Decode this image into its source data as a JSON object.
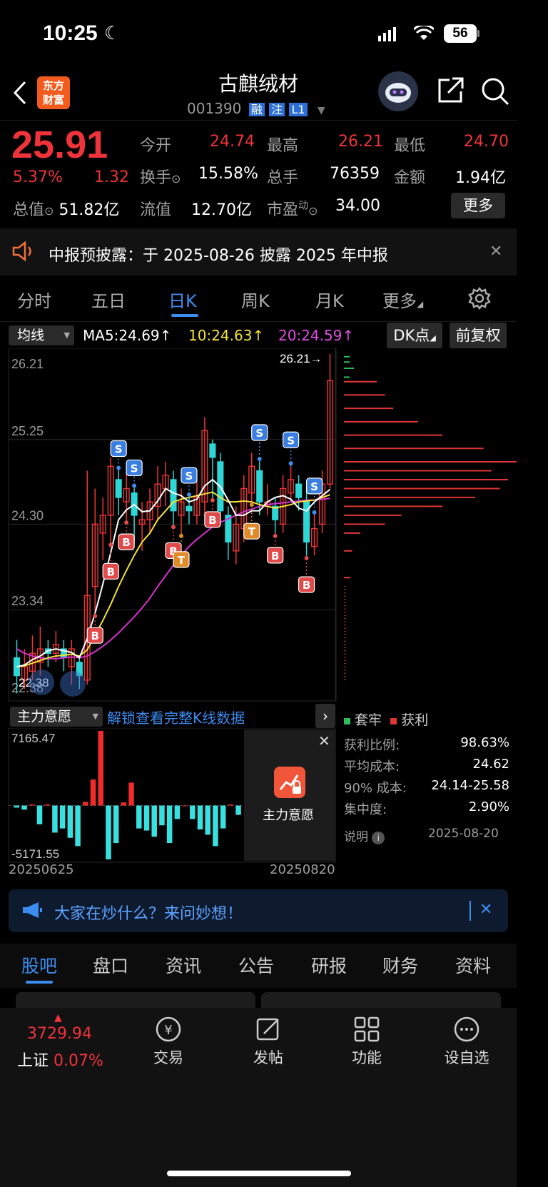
{
  "status_bar": {
    "time": "10:25",
    "battery": "56"
  },
  "header": {
    "logo_line1": "东方",
    "logo_line2": "财富",
    "stock_name": "古麒绒材",
    "stock_code": "001390",
    "tags": [
      "融",
      "注",
      "L1"
    ]
  },
  "quote": {
    "price": "25.91",
    "change_pct": "5.37%",
    "change": "1.32",
    "total_value_label": "总值",
    "total_value": "51.82亿",
    "open_label": "今开",
    "open": "24.74",
    "high_label": "最高",
    "high": "26.21",
    "low_label": "最低",
    "low": "24.70",
    "turnover_label": "换手",
    "turnover": "15.58%",
    "volume_label": "总手",
    "volume": "76359",
    "amount_label": "金额",
    "amount": "1.94亿",
    "float_label": "流值",
    "float_value": "12.70亿",
    "pe_label": "市盈",
    "pe_sup": "动",
    "pe": "34.00",
    "more_button": "更多"
  },
  "notice": {
    "text": "中报预披露：于 2025-08-26 披露 2025 年中报"
  },
  "tabs": {
    "items": [
      "分时",
      "五日",
      "日K",
      "周K",
      "月K",
      "更多"
    ],
    "active": "日K"
  },
  "ma_bar": {
    "dropdown": "均线",
    "ma5": "MA5:24.69↑",
    "ma10": "10:24.63↑",
    "ma20": "20:24.59↑",
    "dk_button": "DK点",
    "adjust_button": "前复权",
    "ma5_color": "#ffffff",
    "ma10_color": "#f5e236",
    "ma20_color": "#d62fd0"
  },
  "kline": {
    "price_labels": [
      "26.21",
      "25.25",
      "24.30",
      "23.34",
      "22.38"
    ],
    "max_marker": "26.21→",
    "min_marker": "22.38",
    "signal_s": "S",
    "signal_b": "B",
    "signal_t": "T"
  },
  "indicator": {
    "dropdown": "主力意愿",
    "unlock_text": "解锁查看完整K线数据",
    "max": "7165.47",
    "min": "-5171.55",
    "date_start": "20250625",
    "date_end": "20250820",
    "lock_label": "主力意愿"
  },
  "chip": {
    "legend_trapped": "套牢",
    "legend_profit": "获利",
    "rows": [
      {
        "label": "获利比例:",
        "value": "98.63%"
      },
      {
        "label": "平均成本:",
        "value": "24.62"
      },
      {
        "label": "90% 成本:",
        "value": "24.14-25.58"
      },
      {
        "label": "集中度:",
        "value": "2.90%"
      }
    ],
    "note_label": "说明",
    "note_date": "2025-08-20"
  },
  "ask_banner": {
    "text": "大家在炒什么？来问妙想！"
  },
  "section_tabs": {
    "items": [
      "股吧",
      "盘口",
      "资讯",
      "公告",
      "研报",
      "财务",
      "资料"
    ],
    "active": "股吧"
  },
  "bottom_nav": {
    "index_value": "3729.94",
    "index_name": "上证",
    "index_change": "0.07%",
    "items": [
      "交易",
      "发帖",
      "功能",
      "设自选"
    ]
  },
  "chart_data": {
    "type": "candlestick",
    "y_range": [
      22.38,
      26.21
    ],
    "candles": [
      [
        22.8,
        22.6,
        23.0,
        22.4
      ],
      [
        22.55,
        22.7,
        22.9,
        22.45
      ],
      [
        22.65,
        22.85,
        23.05,
        22.55
      ],
      [
        22.75,
        22.9,
        23.15,
        22.6
      ],
      [
        22.9,
        22.85,
        23.0,
        22.7
      ],
      [
        22.85,
        22.95,
        23.1,
        22.75
      ],
      [
        22.9,
        22.8,
        23.0,
        22.65
      ],
      [
        22.7,
        22.9,
        23.0,
        22.5
      ],
      [
        22.75,
        22.6,
        22.8,
        22.45
      ],
      [
        22.55,
        23.5,
        24.9,
        22.5
      ],
      [
        23.6,
        24.3,
        24.7,
        23.3
      ],
      [
        24.2,
        24.4,
        24.6,
        23.9
      ],
      [
        24.4,
        24.95,
        25.05,
        24.1
      ],
      [
        24.8,
        24.6,
        24.9,
        24.4
      ],
      [
        24.55,
        24.7,
        24.95,
        24.35
      ],
      [
        24.65,
        24.4,
        24.7,
        24.1
      ],
      [
        24.3,
        24.35,
        24.55,
        24.0
      ],
      [
        24.35,
        24.55,
        24.7,
        24.2
      ],
      [
        24.5,
        24.75,
        24.95,
        24.35
      ],
      [
        24.7,
        24.85,
        25.0,
        24.5
      ],
      [
        24.8,
        24.45,
        24.9,
        24.3
      ],
      [
        24.4,
        24.55,
        24.7,
        24.2
      ],
      [
        24.5,
        24.45,
        24.6,
        24.3
      ],
      [
        24.4,
        24.6,
        24.8,
        24.3
      ],
      [
        24.55,
        25.35,
        25.5,
        24.4
      ],
      [
        25.2,
        25.05,
        25.25,
        24.6
      ],
      [
        25.0,
        24.45,
        25.1,
        24.3
      ],
      [
        24.4,
        24.1,
        24.5,
        23.9
      ],
      [
        24.0,
        24.3,
        24.5,
        23.85
      ],
      [
        24.25,
        24.7,
        24.85,
        24.1
      ],
      [
        24.65,
        24.95,
        25.1,
        24.55
      ],
      [
        24.9,
        24.55,
        25.0,
        24.4
      ],
      [
        24.5,
        24.55,
        24.75,
        24.4
      ],
      [
        24.5,
        24.35,
        24.6,
        24.2
      ],
      [
        24.3,
        24.7,
        24.85,
        24.2
      ],
      [
        24.65,
        24.8,
        24.95,
        24.55
      ],
      [
        24.75,
        24.6,
        24.85,
        24.45
      ],
      [
        24.55,
        24.1,
        24.7,
        23.95
      ],
      [
        24.05,
        24.25,
        24.4,
        23.95
      ],
      [
        24.3,
        24.75,
        24.9,
        24.2
      ],
      [
        24.75,
        25.91,
        26.21,
        24.7
      ]
    ],
    "ma5": [
      22.7,
      22.72,
      22.78,
      22.82,
      22.88,
      22.9,
      22.88,
      22.86,
      22.8,
      23.02,
      23.3,
      23.63,
      23.98,
      24.35,
      24.46,
      24.52,
      24.44,
      24.45,
      24.56,
      24.7,
      24.65,
      24.62,
      24.55,
      24.58,
      24.73,
      24.8,
      24.72,
      24.57,
      24.4,
      24.4,
      24.45,
      24.45,
      24.55,
      24.6,
      24.62,
      24.58,
      24.48,
      24.45,
      24.55,
      24.62,
      24.69
    ],
    "ma10": [
      22.7,
      22.71,
      22.74,
      22.77,
      22.8,
      22.82,
      22.83,
      22.84,
      22.82,
      22.89,
      23.05,
      23.22,
      23.4,
      23.6,
      23.78,
      23.95,
      24.1,
      24.2,
      24.35,
      24.45,
      24.55,
      24.58,
      24.6,
      24.62,
      24.64,
      24.66,
      24.6,
      24.55,
      24.55,
      24.56,
      24.55,
      24.52,
      24.5,
      24.48,
      24.5,
      24.52,
      24.55,
      24.56,
      24.57,
      24.6,
      24.63
    ],
    "ma20": [
      22.9,
      22.85,
      22.82,
      22.8,
      22.79,
      22.79,
      22.8,
      22.81,
      22.8,
      22.82,
      22.87,
      22.93,
      23.0,
      23.08,
      23.17,
      23.26,
      23.36,
      23.47,
      23.6,
      23.72,
      23.84,
      23.95,
      24.05,
      24.13,
      24.2,
      24.27,
      24.32,
      24.36,
      24.4,
      24.44,
      24.47,
      24.5,
      24.52,
      24.53,
      24.54,
      24.55,
      24.56,
      24.57,
      24.57,
      24.58,
      24.59
    ],
    "main_force": [
      -0.2,
      -0.4,
      0.1,
      -1.8,
      0.1,
      -2.6,
      -2.2,
      -3.1,
      -3.9,
      0.35,
      2.5,
      7.17,
      -5.17,
      -3.6,
      0.3,
      2.2,
      -2.2,
      -2.4,
      -3.0,
      -1.9,
      -3.6,
      -1.3,
      0.0,
      -1.3,
      -2.3,
      -2.8,
      -3.9,
      -2.2,
      0.1,
      -0.9,
      -3.0,
      2.2,
      -3.7,
      -5.0,
      -4.0,
      -2.9,
      -3.2,
      -2.3,
      -1.9,
      -1.2,
      -0.1
    ],
    "chip_profit": [
      0.2,
      0.25,
      0.3,
      0.45,
      0.6,
      0.85,
      1.2,
      0.9,
      1.0,
      0.95,
      0.8,
      0.6,
      0.35,
      0.25,
      0.1,
      0.05,
      0.04
    ],
    "chip_profit_levels": [
      25.9,
      25.75,
      25.6,
      25.45,
      25.3,
      25.15,
      25.0,
      24.9,
      24.8,
      24.7,
      24.6,
      24.5,
      24.4,
      24.3,
      24.2,
      24.0,
      23.7
    ]
  }
}
